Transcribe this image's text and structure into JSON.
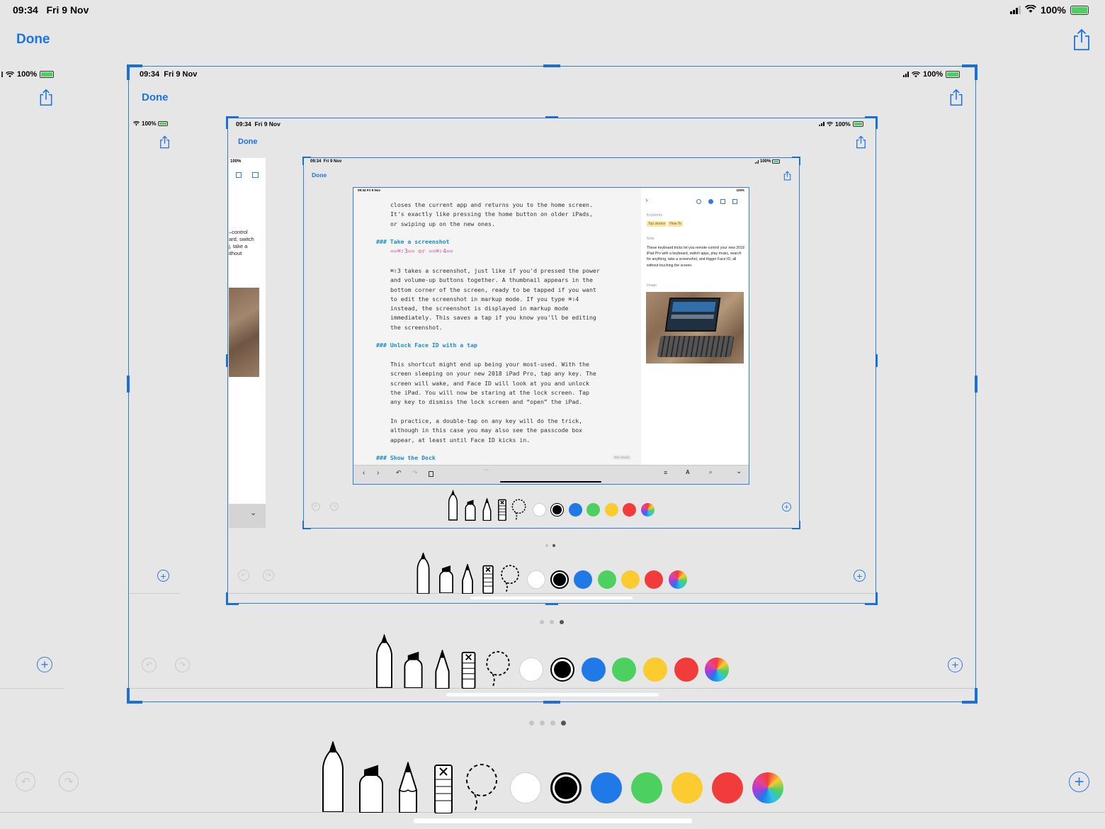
{
  "status": {
    "time": "09:34",
    "date": "Fri 9 Nov",
    "battery": "100%"
  },
  "toolbar": {
    "done_label": "Done"
  },
  "colors": {
    "accent": "#1a73e8",
    "white": "#ffffff",
    "black": "#000000",
    "blue": "#1f7ae8",
    "green": "#4cd05f",
    "yellow": "#fbcb2f",
    "red": "#f23b3b"
  },
  "tools": [
    "pen-icon",
    "marker-icon",
    "pencil-icon",
    "eraser-icon",
    "lasso-icon"
  ],
  "page_dots": {
    "count": 4,
    "active": 4
  },
  "doc": {
    "lines": [
      "closes the current app and returns you to the home screen.",
      "It's exactly like pressing the home button on older iPads,",
      "or swiping up on the new ones."
    ],
    "h1": "### Take a screenshot",
    "k1": "==⌘⇧3== or ==⌘⇧4==",
    "p2": [
      "⌘⇧3 takes a screenshot, just like if you'd pressed the power",
      "and volume-up buttons together. A thumbnail appears in the",
      "bottom corner of the screen, ready to be tapped if you want",
      "to edit the screenshot in markup mode. If you type ⌘⇧4",
      "instead, the screenshot is displayed in markup mode",
      "immediately. This saves a tap if you know you'll be editing",
      "the screenshot."
    ],
    "h2": "### Unlock Face ID with a tap",
    "p3": [
      "This shortcut might end up being your most-used. With the",
      "screen sleeping on your new 2018 iPad Pro, tap any key. The",
      "screen will wake, and Face ID will look at you and unlock",
      "the iPad. You will now be staring at the lock screen. Tap",
      "any key to dismiss the lock screen and “open” the iPad."
    ],
    "p4": [
      "In practice, a double-tap on any key will do the trick,",
      "although in this case you may also see the passcode box",
      "appear, at least until Face ID kicks in."
    ],
    "h3": "### Show the Dock",
    "word_count": "904 Words"
  },
  "inspector": {
    "keywords_label": "Keywords",
    "tags": [
      "Top stories",
      "How-To"
    ],
    "note_label": "Note",
    "note": "These keyboard tricks let you remote-control your new 2018 iPad Pro with a keyboard, switch apps, play music, search for anything, take a screenshot, and trigger Face ID, all without touching the screen.",
    "image_label": "Image"
  },
  "left_peek": {
    "lines": [
      "–control",
      "ard, switch",
      "j, take a",
      "ithout"
    ]
  }
}
